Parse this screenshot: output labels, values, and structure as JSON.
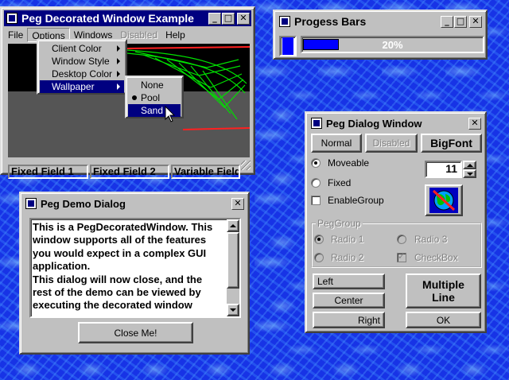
{
  "decorated_window": {
    "title": "Peg Decorated Window Example",
    "menus": [
      "File",
      "Options",
      "Windows",
      "Disabled",
      "Help"
    ],
    "options_menu": [
      "Client Color",
      "Window Style",
      "Desktop Color",
      "Wallpaper"
    ],
    "wallpaper_menu": [
      "None",
      "Pool",
      "Sand"
    ],
    "status_fields": [
      "Fixed Field 1",
      "Fixed Field 2",
      "Variable Field"
    ]
  },
  "progress_window": {
    "title": "Progess Bars",
    "progress_value": 0.2,
    "progress_label": "20%"
  },
  "dialog_window": {
    "title": "Peg Dialog Window",
    "buttons": {
      "normal": "Normal",
      "disabled": "Disabled",
      "bigfont": "BigFont"
    },
    "radios": {
      "moveable": "Moveable",
      "fixed": "Fixed"
    },
    "enable_group": "EnableGroup",
    "spinner_value": "11",
    "group": {
      "title": "PegGroup",
      "radio1": "Radio 1",
      "radio2": "Radio 2",
      "radio3": "Radio 3",
      "checkbox": "CheckBox"
    },
    "left": "Left",
    "center": "Center",
    "right": "Right",
    "multiline": "Multiple Line",
    "ok": "OK"
  },
  "demo_dialog": {
    "title": "Peg Demo Dialog",
    "text_lines": [
      "This is a PegDecoratedWindow. This",
      "window supports all of the features",
      "you would expect in a complex GUI",
      "application.",
      "This dialog will now close, and the",
      "rest of the demo can be viewed by",
      "executing the decorated window"
    ],
    "close_button": "Close Me!"
  },
  "close_glyph": "✕",
  "min_glyph": "_",
  "max_glyph": "□"
}
